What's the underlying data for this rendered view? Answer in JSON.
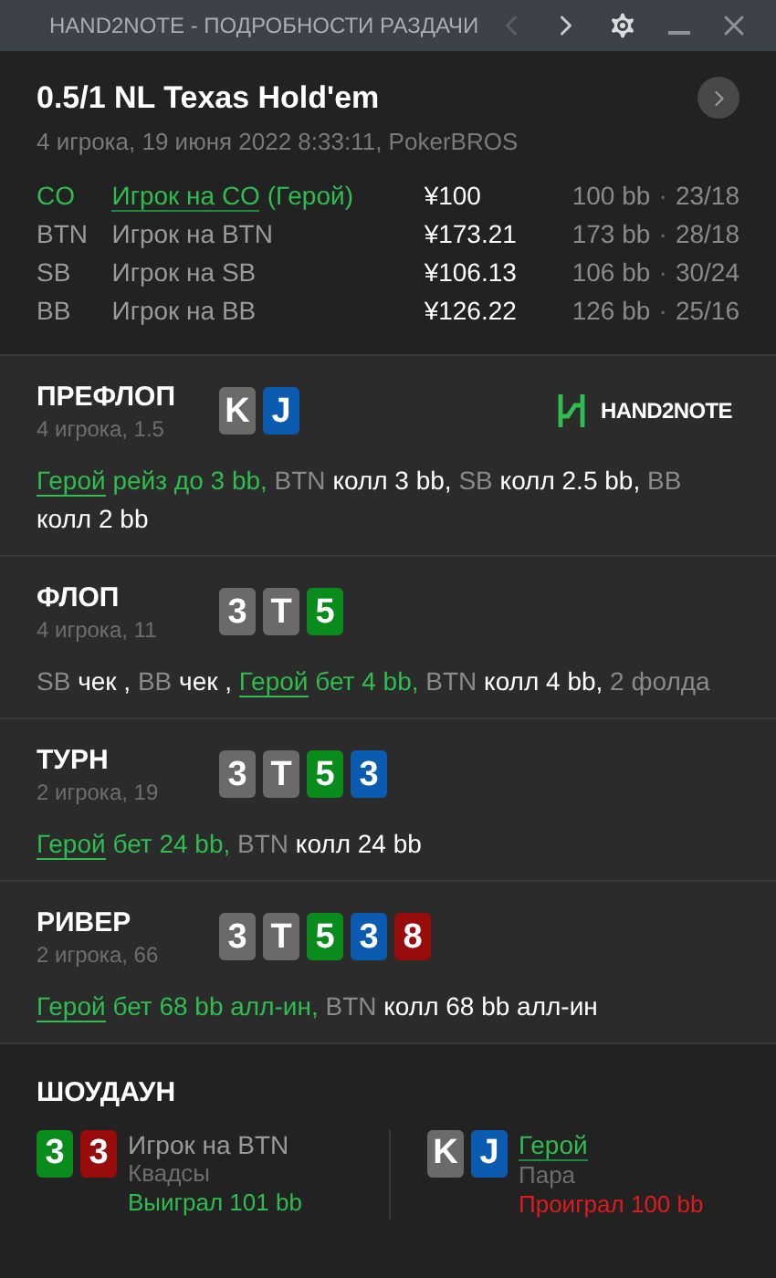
{
  "window": {
    "title": "HAND2NOTE - ПОДРОБНОСТИ РАЗДАЧИ",
    "nav": [
      {
        "kind": "prev",
        "disabled": true
      },
      {
        "kind": "next",
        "disabled": false
      }
    ]
  },
  "hand": {
    "title": "0.5/1 NL Texas Hold'em",
    "subtitle": "4 игрока, 19 июня 2022 8:33:11, PokerBROS",
    "players": [
      {
        "position": "CO",
        "name": "Игрок на CO",
        "suffix": " (Герой)",
        "hero": true,
        "stack": "¥100",
        "bb": "100 bb",
        "sep": "·",
        "stats": "23/18"
      },
      {
        "position": "BTN",
        "name": "Игрок на BTN",
        "hero": false,
        "stack": "¥173.21",
        "bb": "173 bb",
        "sep": "·",
        "stats": "28/18"
      },
      {
        "position": "SB",
        "name": "Игрок на SB",
        "hero": false,
        "stack": "¥106.13",
        "bb": "106 bb",
        "sep": "·",
        "stats": "30/24"
      },
      {
        "position": "BB",
        "name": "Игрок на BB",
        "hero": false,
        "stack": "¥126.22",
        "bb": "126 bb",
        "sep": "·",
        "stats": "25/16"
      }
    ]
  },
  "streets": [
    {
      "name": "ПРЕФЛОП",
      "info": "4 игрока, 1.5",
      "logo": "HAND2NOTE",
      "cards": [
        {
          "rank": "K",
          "color": "#6a6a6a"
        },
        {
          "rank": "J",
          "color": "#0b5cb0"
        }
      ],
      "actions": [
        {
          "kind": "hero-link",
          "text": "Герой"
        },
        {
          "kind": "hero",
          "text": " рейз до 3 bb, "
        },
        {
          "kind": "pos",
          "text": "BTN "
        },
        {
          "kind": "act",
          "text": "колл 3 bb, "
        },
        {
          "kind": "pos",
          "text": "SB "
        },
        {
          "kind": "act",
          "text": "колл 2.5 bb, "
        },
        {
          "kind": "pos",
          "text": "BB "
        },
        {
          "kind": "act",
          "text": "колл 2 bb"
        }
      ]
    },
    {
      "name": "ФЛОП",
      "info": "4 игрока, 11",
      "cards": [
        {
          "rank": "3",
          "color": "#6a6a6a"
        },
        {
          "rank": "T",
          "color": "#6a6a6a"
        },
        {
          "rank": "5",
          "color": "#0a8c1c"
        }
      ],
      "actions": [
        {
          "kind": "pos",
          "text": "SB "
        },
        {
          "kind": "act",
          "text": "чек , "
        },
        {
          "kind": "pos",
          "text": "BB "
        },
        {
          "kind": "act",
          "text": "чек , "
        },
        {
          "kind": "hero-link",
          "text": "Герой"
        },
        {
          "kind": "hero",
          "text": " бет 4 bb, "
        },
        {
          "kind": "pos",
          "text": "BTN "
        },
        {
          "kind": "act",
          "text": "колл 4 bb, "
        },
        {
          "kind": "pos",
          "text": "2 фолда"
        }
      ]
    },
    {
      "name": "ТУРН",
      "info": "2 игрока, 19",
      "cards": [
        {
          "rank": "3",
          "color": "#6a6a6a"
        },
        {
          "rank": "T",
          "color": "#6a6a6a"
        },
        {
          "rank": "5",
          "color": "#0a8c1c"
        },
        {
          "rank": "3",
          "color": "#0b5cb0"
        }
      ],
      "actions": [
        {
          "kind": "hero-link",
          "text": "Герой"
        },
        {
          "kind": "hero",
          "text": " бет 24 bb, "
        },
        {
          "kind": "pos",
          "text": "BTN "
        },
        {
          "kind": "act",
          "text": "колл 24 bb"
        }
      ]
    },
    {
      "name": "РИВЕР",
      "info": "2 игрока, 66",
      "cards": [
        {
          "rank": "3",
          "color": "#6a6a6a"
        },
        {
          "rank": "T",
          "color": "#6a6a6a"
        },
        {
          "rank": "5",
          "color": "#0a8c1c"
        },
        {
          "rank": "3",
          "color": "#0b5cb0"
        },
        {
          "rank": "8",
          "color": "#980c0c"
        }
      ],
      "actions": [
        {
          "kind": "hero-link",
          "text": "Герой"
        },
        {
          "kind": "hero",
          "text": " бет 68 bb алл-ин, "
        },
        {
          "kind": "pos",
          "text": "BTN "
        },
        {
          "kind": "act",
          "text": "колл 68 bb алл-ин"
        }
      ]
    }
  ],
  "showdown": {
    "title": "ШОУДАУН",
    "players": [
      {
        "name": "Игрок на BTN",
        "hero": false,
        "hand": "Квадсы",
        "result": "Выиграл 101 bb",
        "won": true,
        "cards": [
          {
            "rank": "3",
            "color": "#0a8c1c"
          },
          {
            "rank": "3",
            "color": "#980c0c"
          }
        ]
      },
      {
        "name": "Герой",
        "hero": true,
        "hand": "Пара",
        "result": "Проиграл 100 bb",
        "won": false,
        "cards": [
          {
            "rank": "K",
            "color": "#6a6a6a"
          },
          {
            "rank": "J",
            "color": "#0b5cb0"
          }
        ]
      }
    ]
  }
}
